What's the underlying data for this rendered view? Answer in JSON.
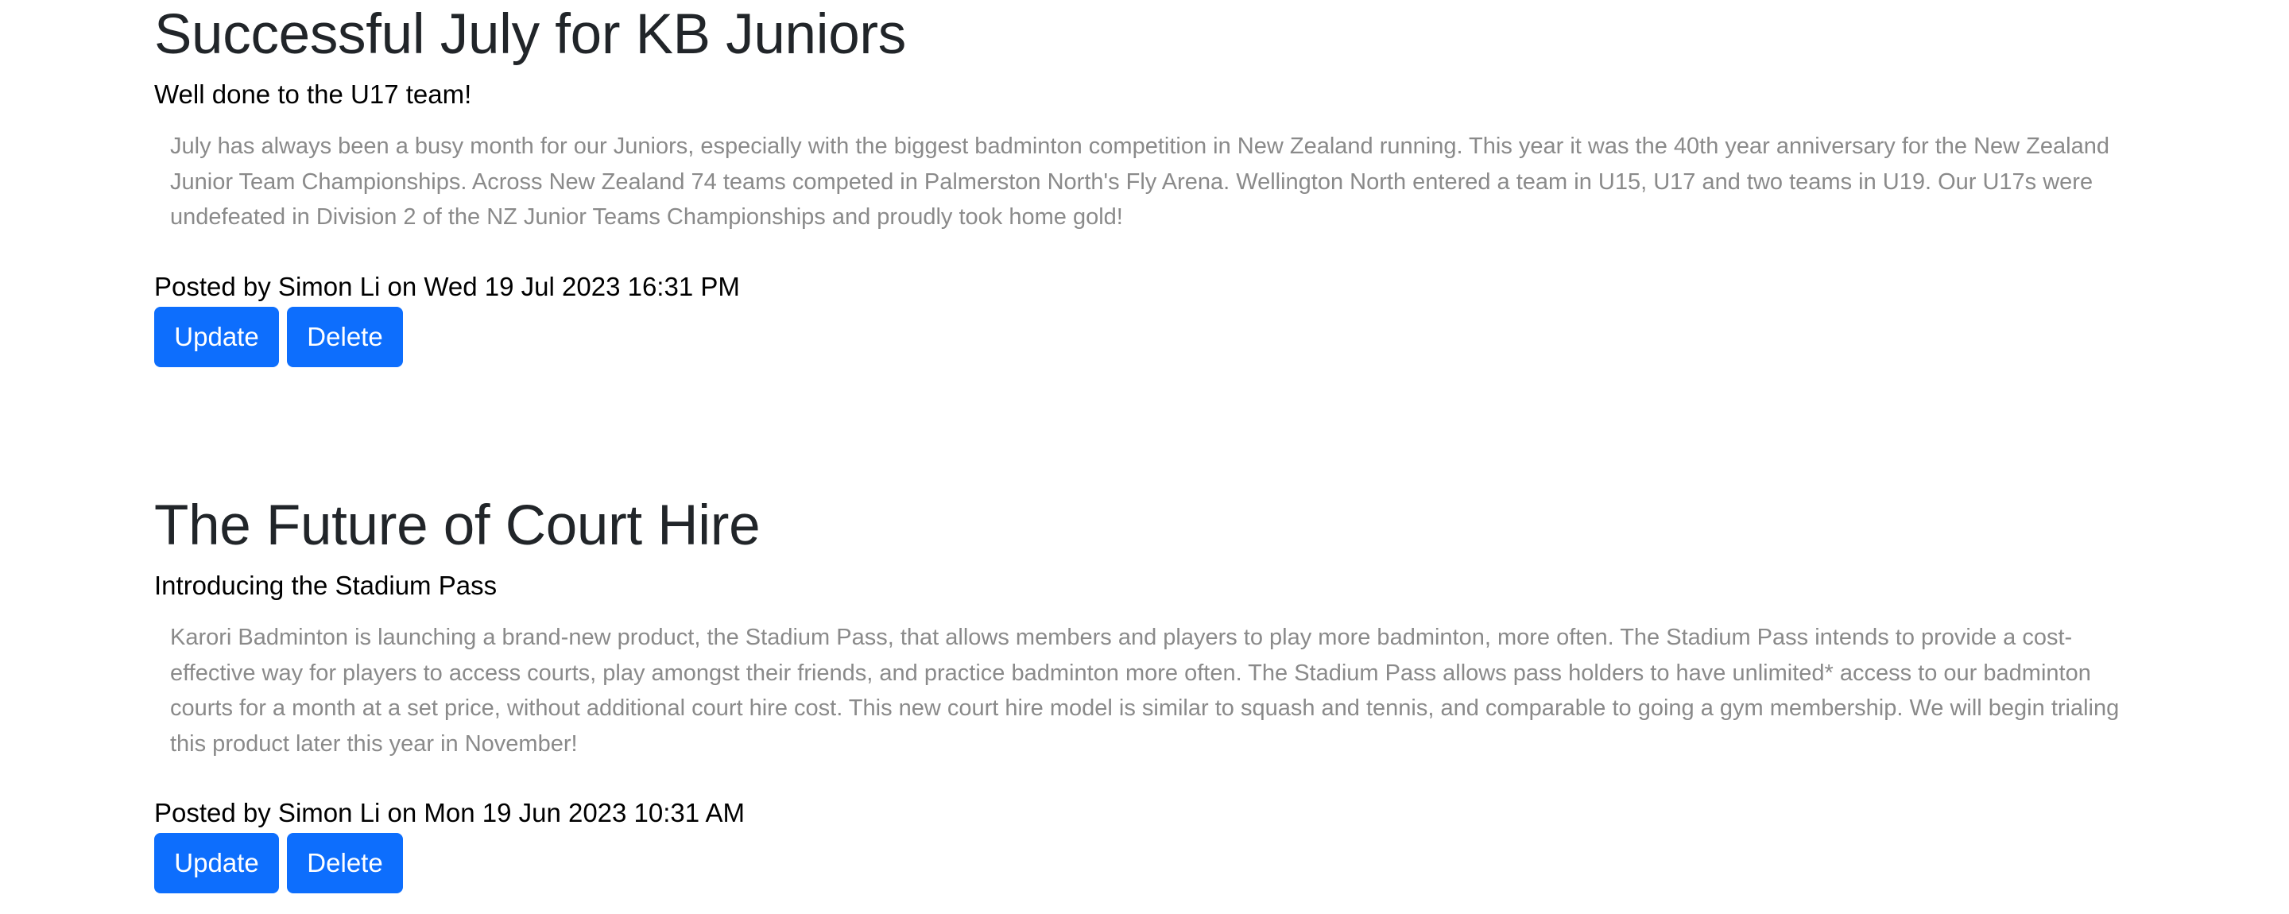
{
  "posts": [
    {
      "title": "Successful July for KB Juniors",
      "subtitle": "Well done to the U17 team!",
      "body": "July has always been a busy month for our Juniors, especially with the biggest badminton competition in New Zealand running. This year it was the 40th year anniversary for the New Zealand Junior Team Championships. Across New Zealand 74 teams competed in Palmerston North's Fly Arena. Wellington North entered a team in U15, U17 and two teams in U19. Our U17s were undefeated in Division 2 of the NZ Junior Teams Championships and proudly took home gold!",
      "meta": "Posted by Simon Li on Wed 19 Jul 2023 16:31 PM",
      "update_label": "Update",
      "delete_label": "Delete"
    },
    {
      "title": "The Future of Court Hire",
      "subtitle": "Introducing the Stadium Pass",
      "body": "Karori Badminton is launching a brand-new product, the Stadium Pass, that allows members and players to play more badminton, more often. The Stadium Pass intends to provide a cost-effective way for players to access courts, play amongst their friends, and practice badminton more often. The Stadium Pass allows pass holders to have unlimited* access to our badminton courts for a month at a set price, without additional court hire cost. This new court hire model is similar to squash and tennis, and comparable to going a gym membership. We will begin trialing this product later this year in November!",
      "meta": "Posted by Simon Li on Mon 19 Jun 2023 10:31 AM",
      "update_label": "Update",
      "delete_label": "Delete"
    }
  ],
  "colors": {
    "button": "#0d6efd",
    "body_text": "#8a8a8a",
    "title_text": "#212529"
  }
}
